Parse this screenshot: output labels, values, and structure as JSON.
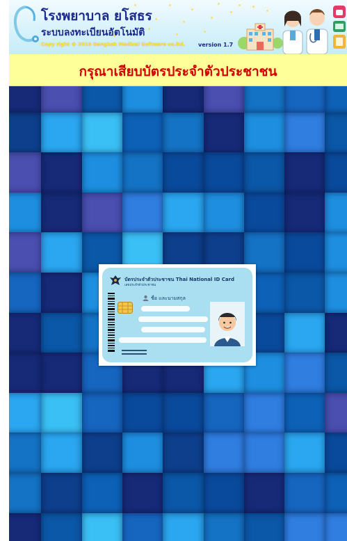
{
  "header": {
    "hospital_name": "โรงพยาบาล ยโสธร",
    "system_name": "ระบบลงทะเบียนอัตโนมัติ",
    "copyright": "Copy right © 2016 Bangkok Medical Software co.ltd.",
    "version": "version 1.7"
  },
  "prompt": {
    "text": "กรุณาเสียบบัตรประจำตัวประชาชน"
  },
  "id_card": {
    "title": "บัตรประจำตัวประชาชน  Thai National ID Card",
    "subtitle": "เลขประจำตัวประชาชน",
    "name_label": "ชื่อ และนามสกุล"
  },
  "colors": {
    "prompt_bg": "#ffff99",
    "prompt_text": "#d40000",
    "title_blue": "#1b2a8c",
    "card_bg": "#a9dff0"
  },
  "tile_palette": [
    "#1473c4",
    "#0b58a8",
    "#1e8fe0",
    "#2aa7f0",
    "#0e3f8c",
    "#162a78",
    "#4a4fb0",
    "#0d62b8",
    "#2f7ee0",
    "#3ac0f5",
    "#1666c0",
    "#0a4a9c"
  ]
}
